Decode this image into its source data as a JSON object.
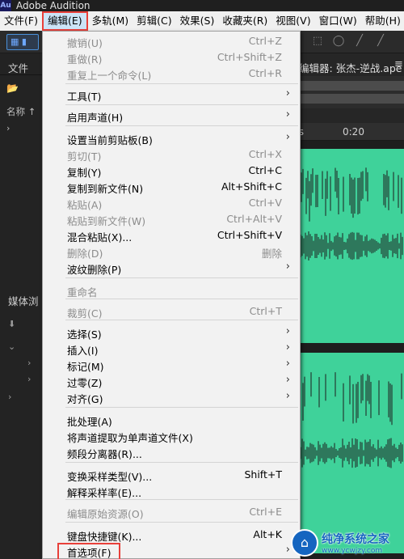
{
  "app": {
    "icon_text": "Au",
    "title": "Adobe Audition"
  },
  "menubar": [
    "文件(F)",
    "编辑(E)",
    "多轨(M)",
    "剪辑(C)",
    "效果(S)",
    "收藏夹(R)",
    "视图(V)",
    "窗口(W)",
    "帮助(H)"
  ],
  "toolbar": {
    "mode_button": "▦ ▮"
  },
  "files_panel": {
    "tab": "文件",
    "name_header": "名称 ↑"
  },
  "media_panel": {
    "tab": "媒体浏"
  },
  "editor": {
    "title": "编辑器: 张杰-逆战.ape",
    "menu_icon": "≡",
    "ruler": {
      "label_1": "ms",
      "label_2": "0:20"
    }
  },
  "edit_menu": {
    "items": [
      {
        "label": "撤销(U)",
        "shortcut": "Ctrl+Z",
        "disabled": true,
        "submenu": false
      },
      {
        "label": "重做(R)",
        "shortcut": "Ctrl+Shift+Z",
        "disabled": true,
        "submenu": false
      },
      {
        "label": "重复上一个命令(L)",
        "shortcut": "Ctrl+R",
        "disabled": true,
        "submenu": false
      },
      {
        "label": "工具(T)",
        "shortcut": "",
        "disabled": false,
        "submenu": true
      },
      {
        "label": "启用声道(H)",
        "shortcut": "",
        "disabled": false,
        "submenu": true
      },
      {
        "label": "设置当前剪贴板(B)",
        "shortcut": "",
        "disabled": false,
        "submenu": true
      },
      {
        "label": "剪切(T)",
        "shortcut": "Ctrl+X",
        "disabled": true,
        "submenu": false
      },
      {
        "label": "复制(Y)",
        "shortcut": "Ctrl+C",
        "disabled": false,
        "submenu": false
      },
      {
        "label": "复制到新文件(N)",
        "shortcut": "Alt+Shift+C",
        "disabled": false,
        "submenu": false
      },
      {
        "label": "粘贴(A)",
        "shortcut": "Ctrl+V",
        "disabled": true,
        "submenu": false
      },
      {
        "label": "粘贴到新文件(W)",
        "shortcut": "Ctrl+Alt+V",
        "disabled": true,
        "submenu": false
      },
      {
        "label": "混合粘贴(X)...",
        "shortcut": "Ctrl+Shift+V",
        "disabled": false,
        "submenu": false
      },
      {
        "label": "删除(D)",
        "shortcut": "删除",
        "disabled": true,
        "submenu": false
      },
      {
        "label": "波纹删除(P)",
        "shortcut": "",
        "disabled": false,
        "submenu": true
      },
      {
        "label": "重命名",
        "shortcut": "",
        "disabled": true,
        "submenu": false
      },
      {
        "label": "裁剪(C)",
        "shortcut": "Ctrl+T",
        "disabled": true,
        "submenu": false
      },
      {
        "label": "选择(S)",
        "shortcut": "",
        "disabled": false,
        "submenu": true
      },
      {
        "label": "插入(I)",
        "shortcut": "",
        "disabled": false,
        "submenu": true
      },
      {
        "label": "标记(M)",
        "shortcut": "",
        "disabled": false,
        "submenu": true
      },
      {
        "label": "过零(Z)",
        "shortcut": "",
        "disabled": false,
        "submenu": true
      },
      {
        "label": "对齐(G)",
        "shortcut": "",
        "disabled": false,
        "submenu": true
      },
      {
        "label": "批处理(A)",
        "shortcut": "",
        "disabled": false,
        "submenu": false
      },
      {
        "label": "将声道提取为单声道文件(X)",
        "shortcut": "",
        "disabled": false,
        "submenu": false
      },
      {
        "label": "频段分离器(R)...",
        "shortcut": "",
        "disabled": false,
        "submenu": false
      },
      {
        "label": "变换采样类型(V)...",
        "shortcut": "Shift+T",
        "disabled": false,
        "submenu": false
      },
      {
        "label": "解释采样率(E)...",
        "shortcut": "",
        "disabled": false,
        "submenu": false
      },
      {
        "label": "编辑原始资源(O)",
        "shortcut": "Ctrl+E",
        "disabled": true,
        "submenu": false
      },
      {
        "label": "键盘快捷键(K)...",
        "shortcut": "Alt+K",
        "disabled": false,
        "submenu": false
      },
      {
        "label": "首选项(F)",
        "shortcut": "",
        "disabled": false,
        "submenu": true
      }
    ]
  },
  "watermark": {
    "title": "纯净系统之家",
    "url": "www.ycwjzy.com"
  },
  "colors": {
    "waveform": "#3fd29a",
    "highlight_border": "#e8403a"
  }
}
